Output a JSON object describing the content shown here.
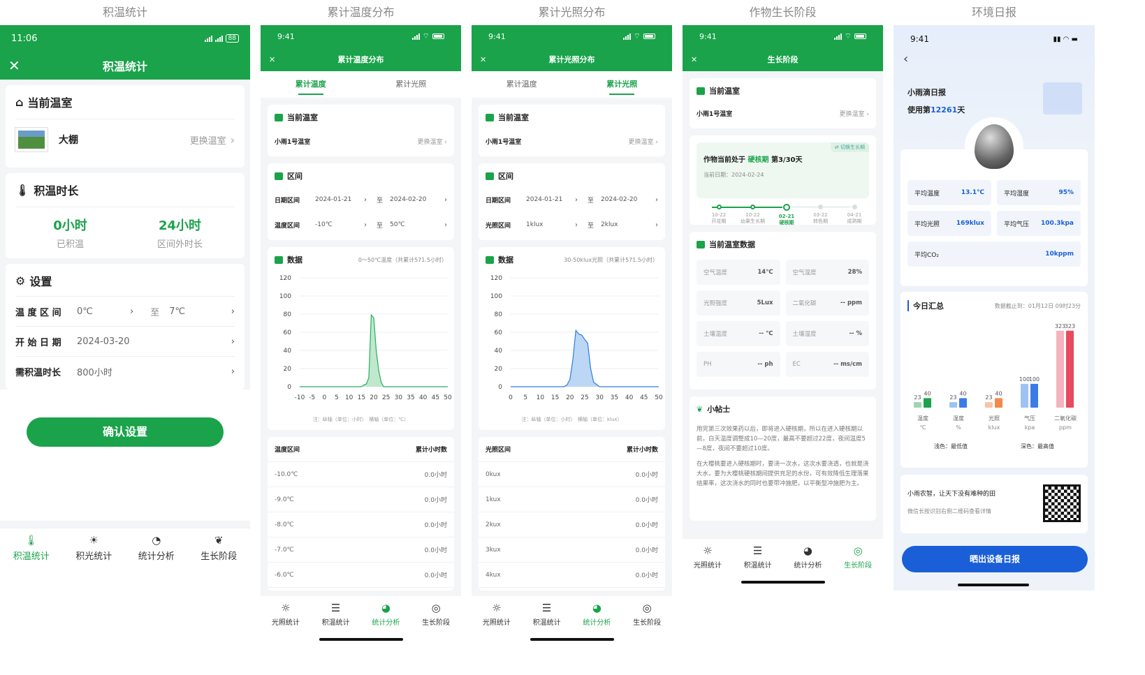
{
  "titles": [
    "积温统计",
    "累计温度分布",
    "累计光照分布",
    "作物生长阶段",
    "环境日报"
  ],
  "p1": {
    "time": "11:06",
    "battery": "88",
    "nav_title": "积温统计",
    "s_cur": "当前温室",
    "gh_name": "大棚",
    "change": "更换温室",
    "s_dur": "积温时长",
    "v1": "0小时",
    "l1": "已积温",
    "v2": "24小时",
    "l2": "区间外时长",
    "s_set": "设置",
    "r1l": "温 度 区 间",
    "r1a": "0℃",
    "r1to": "至",
    "r1b": "7℃",
    "r2l": "开 始 日 期",
    "r2v": "2024-03-20",
    "r3l": "需积温时长",
    "r3v": "800小时",
    "confirm": "确认设置",
    "bn": [
      "积温统计",
      "积光统计",
      "统计分析",
      "生长阶段"
    ]
  },
  "p2": {
    "time": "9:41",
    "nav_title": "累计温度分布",
    "tab1": "累计温度",
    "tab2": "累计光照",
    "cur": "当前温室",
    "gh": "小雨1号温室",
    "change": "更换温室",
    "range": "区间",
    "dl": "日期区间",
    "d1": "2024-01-21",
    "to": "至",
    "d2": "2024-02-20",
    "tl": "温度区间",
    "t1": "-10℃",
    "t2": "50℃",
    "data": "数据",
    "data_note": "0～50℃温度（共累计571.5小时）",
    "chart_note": "注：纵轴（单位：小时）　横轴（单位：℃）",
    "th1": "温度区间",
    "th2": "累计小时数",
    "rows": [
      [
        "-10.0℃",
        "0.0小时"
      ],
      [
        "-9.0℃",
        "0.0小时"
      ],
      [
        "-8.0℃",
        "0.0小时"
      ],
      [
        "-7.0℃",
        "0.0小时"
      ],
      [
        "-6.0℃",
        "0.0小时"
      ]
    ],
    "bn": [
      "光照统计",
      "积温统计",
      "统计分析",
      "生长阶段"
    ]
  },
  "p3": {
    "time": "9:41",
    "nav_title": "累计光照分布",
    "tab1": "累计温度",
    "tab2": "累计光照",
    "cur": "当前温室",
    "gh": "小雨1号温室",
    "change": "更换温室",
    "range": "区间",
    "dl": "日期区间",
    "d1": "2024-01-21",
    "to": "至",
    "d2": "2024-02-20",
    "ll": "光照区间",
    "l1": "1klux",
    "l2": "2klux",
    "data": "数据",
    "data_note": "30-50klux光照（共累计571.5小时）",
    "chart_note": "注：纵轴（单位：小时）　横轴（单位：klux）",
    "th1": "光照区间",
    "th2": "累计小时数",
    "rows": [
      [
        "0kux",
        "0.0小时"
      ],
      [
        "1kux",
        "0.0小时"
      ],
      [
        "2kux",
        "0.0小时"
      ],
      [
        "3kux",
        "0.0小时"
      ],
      [
        "4kux",
        "0.0小时"
      ]
    ],
    "bn": [
      "光照统计",
      "积温统计",
      "统计分析",
      "生长阶段"
    ]
  },
  "p4": {
    "time": "9:41",
    "nav_title": "生长阶段",
    "cur": "当前温室",
    "gh": "小雨1号温室",
    "change": "更换温室",
    "switch": "切换生长期",
    "stage_pre": "作物当前处于",
    "stage": "硬核期",
    "stage_day": "第3/30天",
    "cur_date": "当前日期：2024-02-24",
    "steps": [
      [
        "10-22",
        "开花期"
      ],
      [
        "10-22",
        "幼果生长期"
      ],
      [
        "02-21",
        "硬核期"
      ],
      [
        "03-22",
        "转色期"
      ],
      [
        "04-21",
        "成熟期"
      ]
    ],
    "data_title": "当前温室数据",
    "cells": [
      [
        "空气温度",
        "14℃"
      ],
      [
        "空气湿度",
        "28%"
      ],
      [
        "光照强度",
        "5Lux"
      ],
      [
        "二氧化碳",
        "-- ppm"
      ],
      [
        "土壤温度",
        "-- ℃"
      ],
      [
        "土壤湿度",
        "-- %"
      ],
      [
        "PH",
        "-- ph"
      ],
      [
        "EC",
        "-- ms/cm"
      ]
    ],
    "tip_title": "小帖士",
    "tip1": "用完第三次效果药以后，即将进入硬核期，所以在进入硬核期以前，白天温度调整成10—20度，最高不要超过22度，夜间温度5—8度，夜间不要超过10度。",
    "tip2": "在大樱桃要进入硬核期时，要浇一次水，这次水要浇透，也就是浇大水，要为大樱桃硬核期间提供充足的水份，可有效降低生理落果结果率，这次浇水的同时也要带冲施肥，以平衡型冲施肥为主。",
    "bn": [
      "光照统计",
      "积温统计",
      "统计分析",
      "生长阶段"
    ]
  },
  "p5": {
    "time": "9:41",
    "brand": "小雨滴日报",
    "use_pre": "使用第",
    "use_days": "12261",
    "use_suf": "天",
    "stats": [
      [
        "平均温度",
        "13.1℃"
      ],
      [
        "平均湿度",
        "95%"
      ],
      [
        "平均光照",
        "169klux"
      ],
      [
        "平均气压",
        "100.3kpa"
      ],
      [
        "平均CO₂",
        "10kppm"
      ]
    ],
    "sum_title": "今日汇总",
    "sum_time": "数据截止到：01月12日 09时23分",
    "legend_light": "浅色：最低值",
    "legend_dark": "深色：最高值",
    "cta_title": "小雨农智，让天下没有难种的田",
    "cta_sub": "微信长按识别右侧二维码查看详情",
    "share": "晒出设备日报"
  },
  "colors": {
    "green": "#1aa34a",
    "blue": "#1a5fd8"
  },
  "chart_data": [
    {
      "type": "area",
      "x": [
        -10,
        -5,
        0,
        5,
        10,
        14,
        15,
        16,
        17,
        18,
        19,
        20,
        21,
        22,
        23,
        24,
        25,
        30,
        35,
        40,
        45,
        50
      ],
      "y": [
        0,
        0,
        0,
        0,
        0,
        0,
        0,
        2,
        3,
        10,
        79,
        76,
        40,
        18,
        5,
        0,
        0,
        0,
        0,
        0,
        0,
        0
      ],
      "xlim": [
        -10,
        50
      ],
      "ylim": [
        0,
        120
      ],
      "xticks": [
        "-10",
        "-5",
        "0",
        "5",
        "10",
        "15",
        "20",
        "25",
        "30",
        "35",
        "40",
        "45",
        "50"
      ],
      "yticks": [
        "0",
        "20",
        "40",
        "60",
        "80",
        "100",
        "120"
      ]
    },
    {
      "type": "area",
      "x": [
        0,
        5,
        10,
        15,
        18,
        19,
        20,
        21,
        22,
        23,
        24,
        25,
        26,
        27,
        28,
        30,
        35,
        40,
        45,
        50
      ],
      "y": [
        0,
        0,
        0,
        0,
        0,
        2,
        8,
        30,
        62,
        58,
        57,
        52,
        48,
        20,
        5,
        0,
        0,
        0,
        0,
        0
      ],
      "xlim": [
        0,
        50
      ],
      "ylim": [
        0,
        120
      ],
      "xticks": [
        "0",
        "5",
        "10",
        "15",
        "20",
        "25",
        "30",
        "35",
        "40",
        "45",
        "50"
      ],
      "yticks": [
        "0",
        "20",
        "40",
        "60",
        "80",
        "100",
        "120"
      ]
    },
    {
      "type": "bar",
      "categories": [
        "温度",
        "湿度",
        "光照",
        "气压",
        "二氧化碳"
      ],
      "units": [
        "℃",
        "%",
        "klux",
        "kpa",
        "ppm"
      ],
      "series": [
        {
          "name": "最低值",
          "values": [
            23,
            23,
            23,
            100,
            323
          ]
        },
        {
          "name": "最高值",
          "values": [
            40,
            40,
            40,
            100,
            323
          ]
        }
      ]
    }
  ]
}
